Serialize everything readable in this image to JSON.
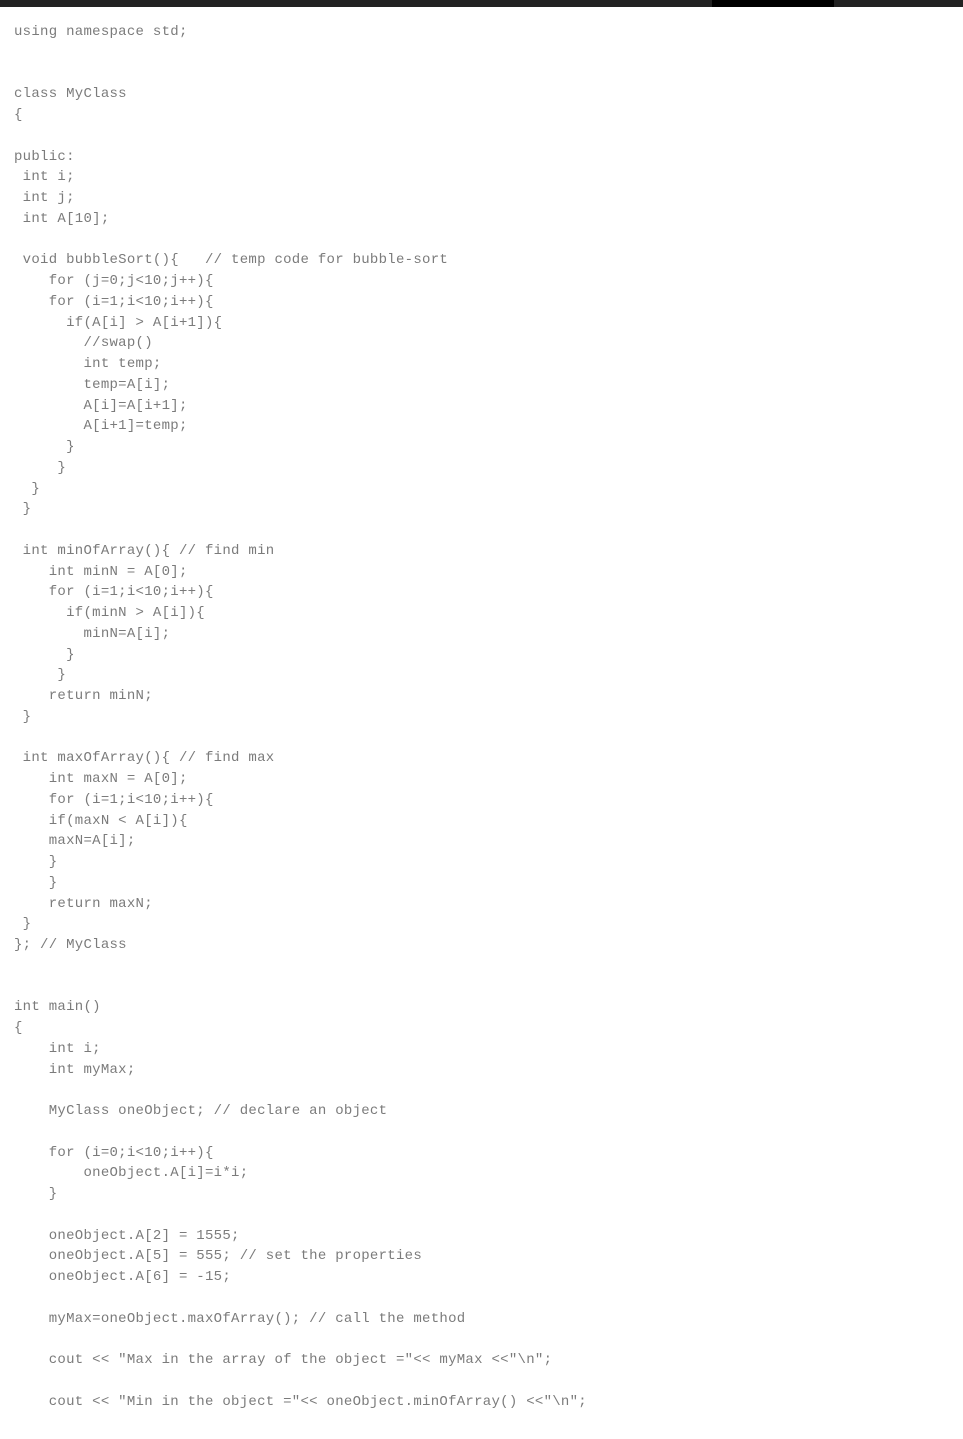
{
  "window": {
    "chrome_bar_color": "#222222",
    "chrome_active_segment_color": "#000000"
  },
  "document": {
    "type": "source-code-listing",
    "language": "C++",
    "text_color": "#7b7b7b",
    "background_color": "#ffffff",
    "lines": [
      "using namespace std;",
      "",
      "",
      "class MyClass",
      "{",
      "",
      "public:",
      " int i;",
      " int j;",
      " int A[10];",
      "",
      " void bubbleSort(){   // temp code for bubble-sort",
      "    for (j=0;j<10;j++){",
      "    for (i=1;i<10;i++){",
      "      if(A[i] > A[i+1]){",
      "        //swap()",
      "        int temp;",
      "        temp=A[i];",
      "        A[i]=A[i+1];",
      "        A[i+1]=temp;",
      "      }",
      "     }",
      "  }",
      " }",
      "",
      " int minOfArray(){ // find min",
      "    int minN = A[0];",
      "    for (i=1;i<10;i++){",
      "      if(minN > A[i]){",
      "        minN=A[i];",
      "      }",
      "     }",
      "    return minN;",
      " }",
      "",
      " int maxOfArray(){ // find max",
      "    int maxN = A[0];",
      "    for (i=1;i<10;i++){",
      "    if(maxN < A[i]){",
      "    maxN=A[i];",
      "    }",
      "    }",
      "    return maxN;",
      " }",
      "}; // MyClass",
      "",
      "",
      "int main()",
      "{",
      "    int i;",
      "    int myMax;",
      "",
      "    MyClass oneObject; // declare an object",
      "",
      "    for (i=0;i<10;i++){",
      "        oneObject.A[i]=i*i;",
      "    }",
      "",
      "    oneObject.A[2] = 1555;",
      "    oneObject.A[5] = 555; // set the properties",
      "    oneObject.A[6] = -15;",
      "",
      "    myMax=oneObject.maxOfArray(); // call the method",
      "",
      "    cout << \"Max in the array of the object =\"<< myMax <<\"\\n\";",
      "",
      "    cout << \"Min in the object =\"<< oneObject.minOfArray() <<\"\\n\";"
    ]
  }
}
